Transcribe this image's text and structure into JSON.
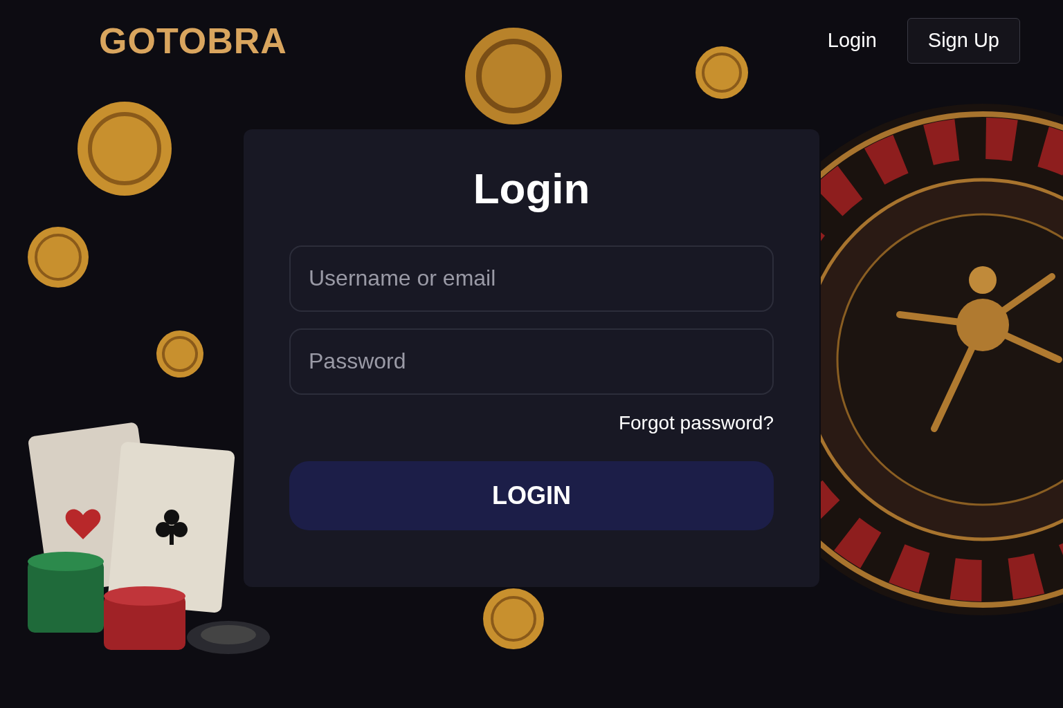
{
  "header": {
    "logo": "GOTOBRA",
    "nav": [
      {
        "label": "Login",
        "kind": "link"
      },
      {
        "label": "Sign Up",
        "kind": "button"
      }
    ]
  },
  "login_form": {
    "title": "Login",
    "fields": [
      {
        "placeholder": "Username or email"
      },
      {
        "placeholder": "Password"
      }
    ],
    "forgot_link": "Forgot password?",
    "submit": "LOGIN"
  }
}
